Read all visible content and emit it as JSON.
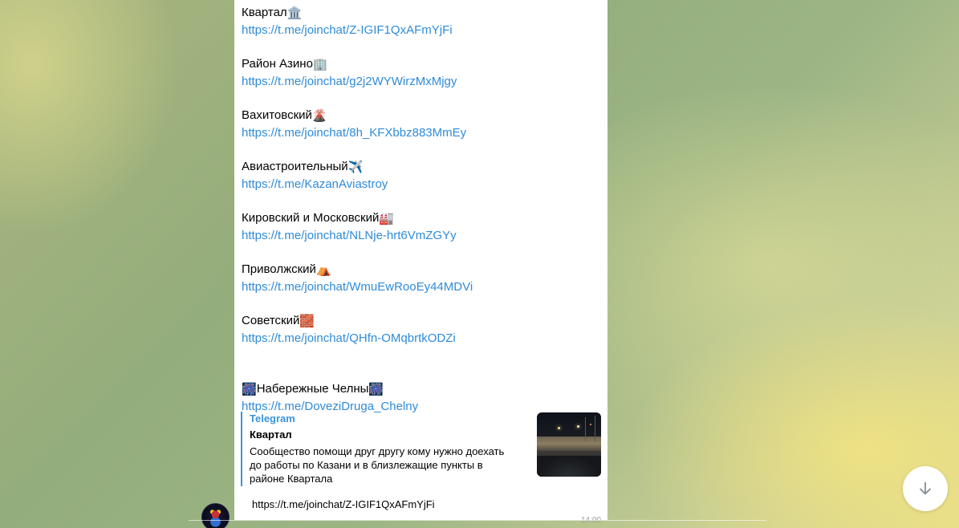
{
  "message": {
    "districts": [
      {
        "name": "Квартал",
        "emoji": "🏛️",
        "link": "https://t.me/joinchat/Z-IGIF1QxAFmYjFi"
      },
      {
        "name": "Район Азино",
        "emoji": "🏢",
        "link": "https://t.me/joinchat/g2j2WYWirzMxMjgy"
      },
      {
        "name": "Вахитовский",
        "emoji": "🌋",
        "link": "https://t.me/joinchat/8h_KFXbbz883MmEy"
      },
      {
        "name": "Авиастроительный",
        "emoji": "✈️",
        "link": "https://t.me/KazanAviastroy"
      },
      {
        "name": "Кировский и Московский",
        "emoji": "🏭",
        "link": "https://t.me/joinchat/NLNje-hrt6VmZGYy"
      },
      {
        "name": "Приволжский",
        "emoji": "⛺",
        "link": "https://t.me/joinchat/WmuEwRooEy44MDVi"
      },
      {
        "name": "Советский",
        "emoji": "🧱",
        "link": "https://t.me/joinchat/QHfn-OMqbrtkODZi"
      },
      {
        "name": "Набережные Челны",
        "emoji": "🎆",
        "emoji_after": "🎆",
        "link": "https://t.me/DoveziDruga_Chelny"
      }
    ],
    "time": "14:00"
  },
  "preview": {
    "site": "Telegram",
    "title": "Квартал",
    "description": "Сообщество помощи друг другу кому нужно доехать до работы по Казани и в близлежащие пункты в районе Квартала",
    "link": "https://t.me/joinchat/Z-IGIF1QxAFmYjFi"
  },
  "controls": {
    "scroll_down_icon": "arrow-down-icon"
  }
}
